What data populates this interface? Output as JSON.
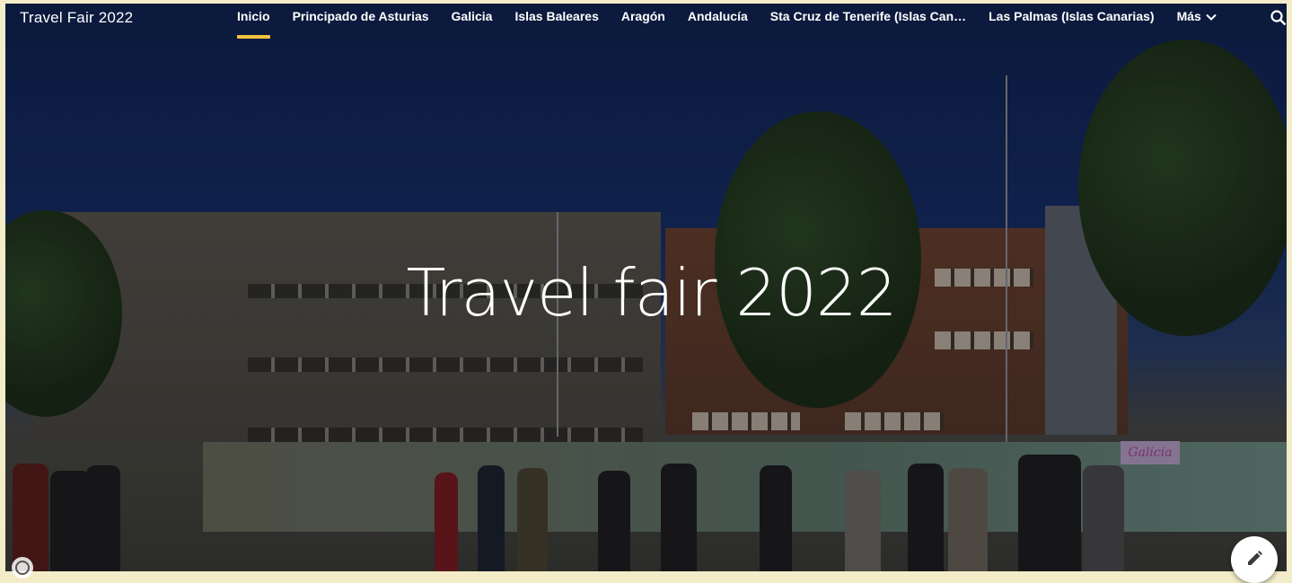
{
  "site": {
    "title": "Travel Fair 2022"
  },
  "nav": {
    "items": [
      {
        "label": "Inicio",
        "active": true
      },
      {
        "label": "Principado de Asturias"
      },
      {
        "label": "Galicia"
      },
      {
        "label": "Islas Baleares"
      },
      {
        "label": "Aragón"
      },
      {
        "label": "Andalucía"
      },
      {
        "label": "Sta Cruz de Tenerife (Islas Can…"
      },
      {
        "label": "Las Palmas (Islas Canarias)"
      }
    ],
    "more_label": "Más",
    "search_icon": "search-icon",
    "more_icon": "chevron-down-icon"
  },
  "hero": {
    "title": "Travel fair 2022",
    "sign_text": "Galicia"
  },
  "colors": {
    "accent": "#f4c43c",
    "page_border": "#f3ecc8"
  },
  "actions": {
    "edit_icon": "pencil-icon",
    "info_icon": "info-icon"
  }
}
